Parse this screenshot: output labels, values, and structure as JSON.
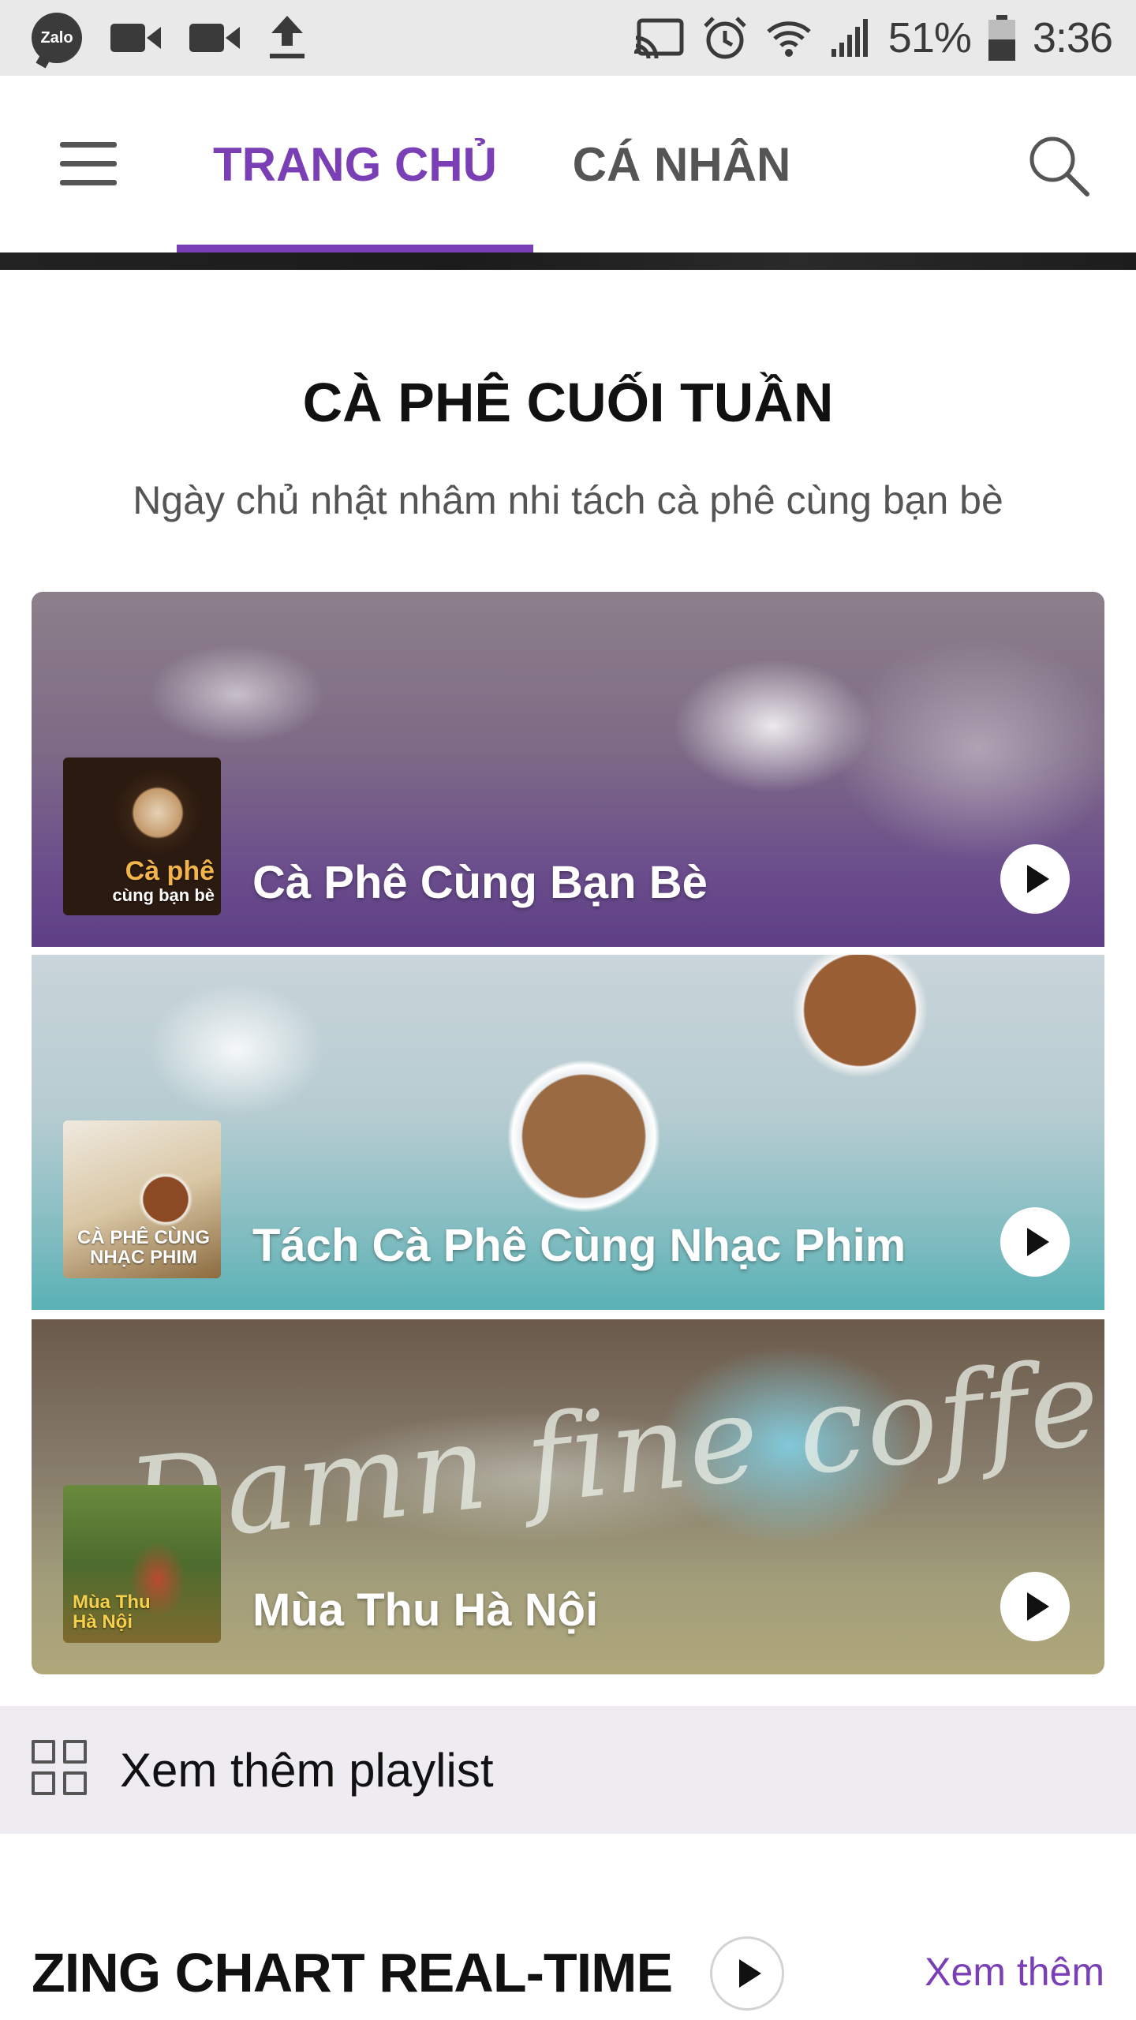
{
  "status_bar": {
    "zalo_label": "Zalo",
    "battery_percent": "51%",
    "time": "3:36",
    "icons": [
      "zalo-icon",
      "video-camera-icon",
      "video-camera-icon",
      "upload-icon",
      "cast-icon",
      "alarm-icon",
      "wifi-icon",
      "signal-icon",
      "battery-icon"
    ]
  },
  "header": {
    "tabs": [
      {
        "label": "TRANG CHỦ",
        "active": true
      },
      {
        "label": "CÁ NHÂN",
        "active": false
      }
    ],
    "icons": {
      "menu": "menu-icon",
      "search": "search-icon"
    },
    "accent_color": "#7b3fb5"
  },
  "section": {
    "title": "CÀ PHÊ CUỐI TUẦN",
    "subtitle": "Ngày chủ nhật nhâm nhi tách cà phê cùng bạn bè"
  },
  "playlists": [
    {
      "title": "Cà Phê Cùng Bạn Bè",
      "thumb_text_1": "Cà phê",
      "thumb_text_2": "cùng bạn bè"
    },
    {
      "title": "Tách Cà Phê Cùng Nhạc Phim",
      "thumb_text_1": "CÀ PHÊ CÙNG",
      "thumb_text_2": "NHẠC PHIM"
    },
    {
      "title": "Mùa Thu Hà Nội",
      "thumb_text_1": "Mùa Thu",
      "thumb_text_2": "Hà Nội",
      "background_text": "Damn fine coffee..."
    }
  ],
  "more_playlists": {
    "label": "Xem thêm playlist"
  },
  "chart": {
    "title": "ZING CHART REAL-TIME",
    "more_label": "Xem thêm"
  }
}
